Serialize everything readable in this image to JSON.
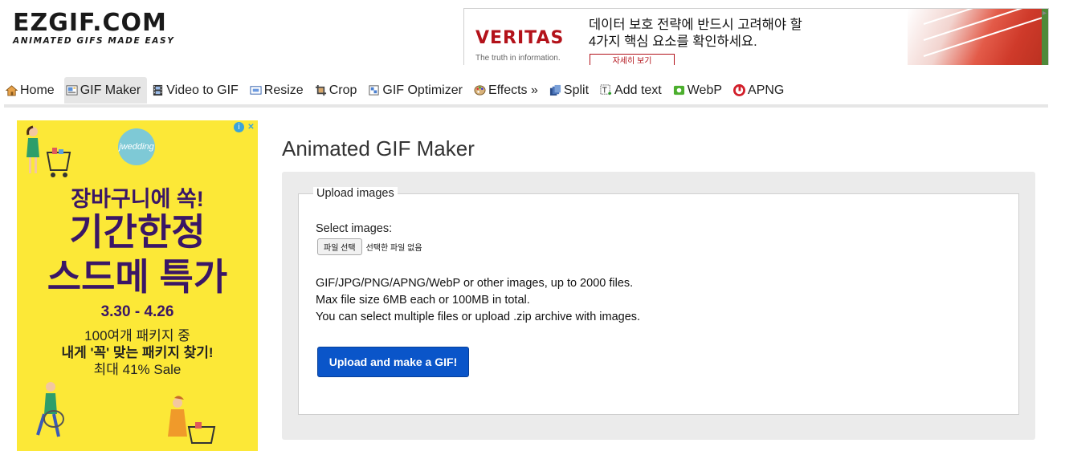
{
  "logo": {
    "main": "EZGIF.COM",
    "tagline": "ANIMATED GIFS MADE EASY"
  },
  "top_ad": {
    "brand": "VERITAS",
    "brand_sub": "The truth in information.",
    "line1": "데이터 보호 전략에 반드시 고려해야 할",
    "line2": "4가지 핵심 요소를 확인하세요.",
    "button": "자세히 보기",
    "accent": "#b3121a"
  },
  "nav": {
    "items": [
      {
        "label": "Home",
        "icon": "home-icon",
        "active": false
      },
      {
        "label": "GIF Maker",
        "icon": "gif-maker-icon",
        "active": true
      },
      {
        "label": "Video to GIF",
        "icon": "film-icon",
        "active": false
      },
      {
        "label": "Resize",
        "icon": "resize-icon",
        "active": false
      },
      {
        "label": "Crop",
        "icon": "crop-icon",
        "active": false
      },
      {
        "label": "GIF Optimizer",
        "icon": "optimizer-icon",
        "active": false
      },
      {
        "label": "Effects »",
        "icon": "palette-icon",
        "active": false
      },
      {
        "label": "Split",
        "icon": "split-icon",
        "active": false
      },
      {
        "label": "Add text",
        "icon": "add-text-icon",
        "active": false
      },
      {
        "label": "WebP",
        "icon": "webp-icon",
        "active": false
      },
      {
        "label": "APNG",
        "icon": "apng-icon",
        "active": false
      }
    ]
  },
  "side_ad": {
    "logo": "jwedding",
    "line1": "장바구니에 쏙!",
    "line2": "기간한정",
    "line3": "스드메 특가",
    "date": "3.30 - 4.26",
    "p1": "100여개 패키지 중",
    "p2": "내게 '꼭' 맞는 패키지 찾기!",
    "p3": "최대 41% Sale",
    "bg": "#fce837"
  },
  "main": {
    "title": "Animated GIF Maker",
    "legend": "Upload images",
    "select_label": "Select images:",
    "file_button": "파일 선택",
    "file_none": "선택한 파일 없음",
    "info": [
      "GIF/JPG/PNG/APNG/WebP or other images, up to 2000 files.",
      "Max file size 6MB each or 100MB in total.",
      "You can select multiple files or upload .zip archive with images."
    ],
    "upload_button": "Upload and make a GIF!",
    "button_color": "#0a55c9"
  }
}
